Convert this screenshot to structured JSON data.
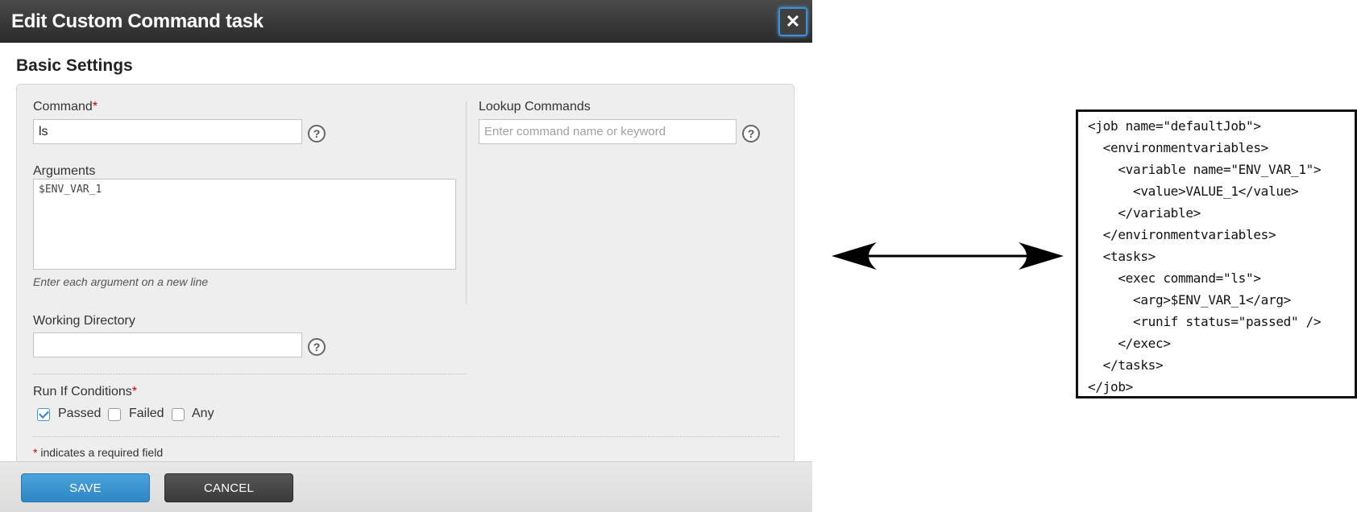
{
  "dialog": {
    "title": "Edit Custom Command task",
    "close_glyph": "✕",
    "section_title": "Basic Settings",
    "command": {
      "label": "Command",
      "required_mark": "*",
      "value": "ls"
    },
    "lookup": {
      "label": "Lookup Commands",
      "placeholder": "Enter command name or keyword"
    },
    "arguments": {
      "label": "Arguments",
      "value": "$ENV_VAR_1",
      "hint": "Enter each argument on a new line"
    },
    "working_directory": {
      "label": "Working Directory",
      "value": ""
    },
    "help_glyph": "?",
    "run_if": {
      "label": "Run If Conditions",
      "required_mark": "*",
      "options": [
        {
          "label": "Passed",
          "checked": true
        },
        {
          "label": "Failed",
          "checked": false
        },
        {
          "label": "Any",
          "checked": false
        }
      ]
    },
    "required_note": {
      "mark": "*",
      "text": " indicates a required field"
    },
    "buttons": {
      "save": "SAVE",
      "cancel": "CANCEL"
    },
    "colors": {
      "save": "#2e86c4",
      "cancel": "#3a3a3a",
      "required": "#cc0000"
    }
  },
  "xml": {
    "lines": [
      "<job name=\"defaultJob\">",
      "  <environmentvariables>",
      "    <variable name=\"ENV_VAR_1\">",
      "      <value>VALUE_1</value>",
      "    </variable>",
      "  </environmentvariables>",
      "  <tasks>",
      "    <exec command=\"ls\">",
      "      <arg>$ENV_VAR_1</arg>",
      "      <runif status=\"passed\" />",
      "    </exec>",
      "  </tasks>",
      "</job>"
    ]
  },
  "icons": {
    "close": "close-icon",
    "help": "help-icon",
    "arrow": "double-arrow-icon"
  }
}
